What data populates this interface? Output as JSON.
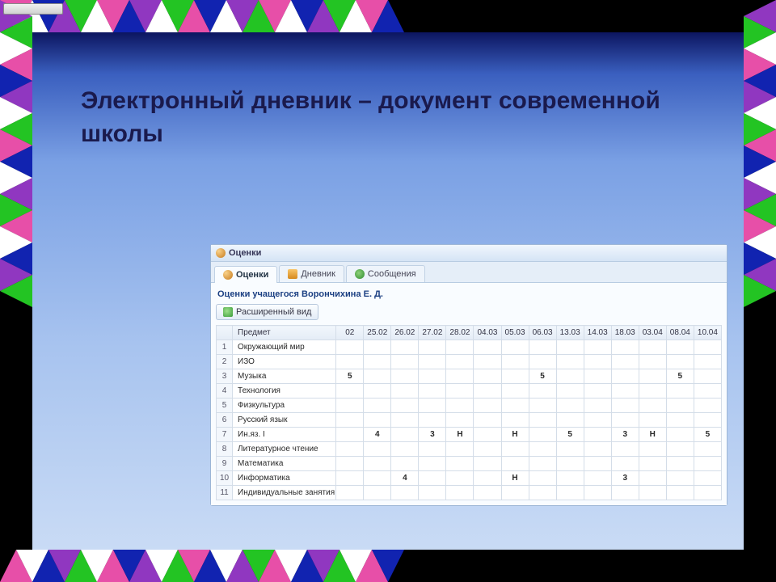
{
  "slide": {
    "title": "Электронный дневник – документ современной школы"
  },
  "window": {
    "title": "Оценки",
    "tabs": [
      {
        "label": "Оценки",
        "active": true
      },
      {
        "label": "Дневник",
        "active": false
      },
      {
        "label": "Сообщения",
        "active": false
      }
    ],
    "caption": "Оценки учащегося Ворончихина Е. Д.",
    "expandBtn": "Расширенный вид"
  },
  "table": {
    "subjectHeader": "Предмет",
    "dates": [
      "02",
      "25.02",
      "26.02",
      "27.02",
      "28.02",
      "04.03",
      "05.03",
      "06.03",
      "13.03",
      "14.03",
      "18.03",
      "03.04",
      "08.04",
      "10.04"
    ],
    "rows": [
      {
        "n": "1",
        "subject": "Окружающий мир",
        "cells": [
          "",
          "",
          "",
          "",
          "",
          "",
          "",
          "",
          "",
          "",
          "",
          "",
          "",
          ""
        ]
      },
      {
        "n": "2",
        "subject": "ИЗО",
        "cells": [
          "",
          "",
          "",
          "",
          "",
          "",
          "",
          "",
          "",
          "",
          "",
          "",
          "",
          ""
        ]
      },
      {
        "n": "3",
        "subject": "Музыка",
        "cells": [
          "5",
          "",
          "",
          "",
          "",
          "",
          "",
          "5",
          "",
          "",
          "",
          "",
          "5",
          ""
        ]
      },
      {
        "n": "4",
        "subject": "Технология",
        "cells": [
          "",
          "",
          "",
          "",
          "",
          "",
          "",
          "",
          "",
          "",
          "",
          "",
          "",
          ""
        ]
      },
      {
        "n": "5",
        "subject": "Физкультура",
        "cells": [
          "",
          "",
          "",
          "",
          "",
          "",
          "",
          "",
          "",
          "",
          "",
          "",
          "",
          ""
        ]
      },
      {
        "n": "6",
        "subject": "Русский язык",
        "cells": [
          "",
          "",
          "",
          "",
          "",
          "",
          "",
          "",
          "",
          "",
          "",
          "",
          "",
          ""
        ]
      },
      {
        "n": "7",
        "subject": "Ин.яз. I",
        "cells": [
          "",
          "4",
          "",
          "3",
          "Н",
          "",
          "Н",
          "",
          "5",
          "",
          "3",
          "Н",
          "",
          "5"
        ]
      },
      {
        "n": "8",
        "subject": "Литературное чтение",
        "cells": [
          "",
          "",
          "",
          "",
          "",
          "",
          "",
          "",
          "",
          "",
          "",
          "",
          "",
          ""
        ]
      },
      {
        "n": "9",
        "subject": "Математика",
        "cells": [
          "",
          "",
          "",
          "",
          "",
          "",
          "",
          "",
          "",
          "",
          "",
          "",
          "",
          ""
        ]
      },
      {
        "n": "10",
        "subject": "Информатика",
        "cells": [
          "",
          "",
          "4",
          "",
          "",
          "",
          "Н",
          "",
          "",
          "",
          "3",
          "",
          "",
          ""
        ]
      },
      {
        "n": "11",
        "subject": "Индивидуальные занятия",
        "cells": [
          "",
          "",
          "",
          "",
          "",
          "",
          "",
          "",
          "",
          "",
          "",
          "",
          "",
          ""
        ]
      }
    ]
  },
  "border": {
    "colors": [
      "#e74fa8",
      "#ffffff",
      "#1123b0",
      "#9037c0",
      "#23c423",
      "#ffffff",
      "#e74fa8",
      "#1123b0",
      "#9037c0",
      "#ffffff",
      "#23c423",
      "#e74fa8",
      "#1123b0",
      "#ffffff",
      "#9037c0",
      "#23c423",
      "#e74fa8",
      "#ffffff",
      "#1123b0",
      "#9037c0",
      "#23c423",
      "#ffffff",
      "#e74fa8",
      "#1123b0"
    ]
  }
}
